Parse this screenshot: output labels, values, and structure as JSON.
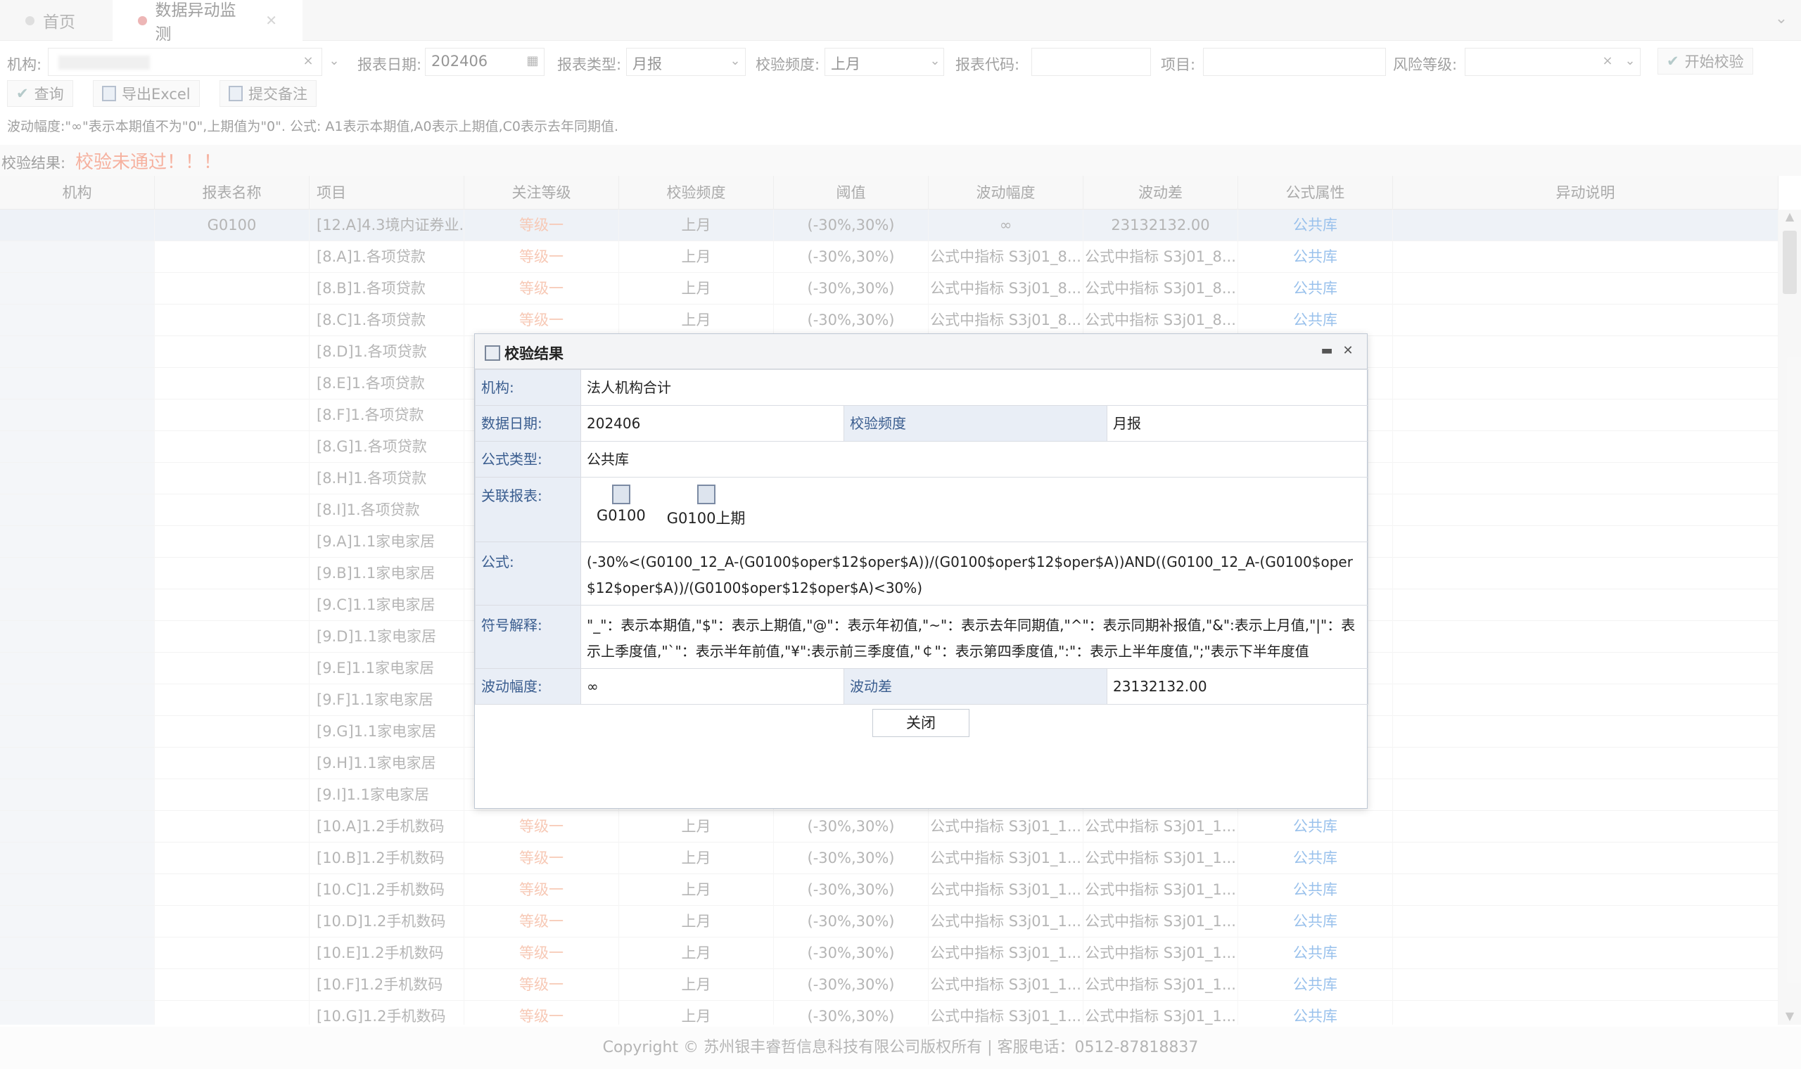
{
  "tabs": [
    {
      "label": "首页"
    },
    {
      "label": "数据异动监测"
    }
  ],
  "filters": {
    "org_label": "机构:",
    "date_label": "报表日期:",
    "date_value": "202406",
    "type_label": "报表类型:",
    "type_value": "月报",
    "freq_label": "校验频度:",
    "freq_value": "上月",
    "code_label": "报表代码:",
    "item_label": "项目:",
    "risk_label": "风险等级:",
    "start_label": "开始校验"
  },
  "toolbar": {
    "query": "查询",
    "export": "导出Excel",
    "submit": "提交备注"
  },
  "hint": "波动幅度:\"∞\"表示本期值不为\"0\",上期值为\"0\".    公式:  A1表示本期值,A0表示上期值,C0表示去年同期值.",
  "result": {
    "label": "校验结果:",
    "value": "校验未通过！！！"
  },
  "columns": [
    "机构",
    "报表名称",
    "项目",
    "关注等级",
    "校验频度",
    "阈值",
    "波动幅度",
    "波动差",
    "公式属性",
    "异动说明"
  ],
  "rows": [
    {
      "report": "G0100",
      "project": "[12.A]4.3境内证券业...",
      "level": "等级一",
      "freq": "上月",
      "threshold": "(-30%,30%)",
      "amp": "∞",
      "diff": "23132132.00",
      "attr": "公共库"
    },
    {
      "report": "",
      "project": "[8.A]1.各项贷款",
      "level": "等级一",
      "freq": "上月",
      "threshold": "(-30%,30%)",
      "amp": "公式中指标 S3j01_8...",
      "diff": "公式中指标 S3j01_8...",
      "attr": "公共库"
    },
    {
      "report": "",
      "project": "[8.B]1.各项贷款",
      "level": "等级一",
      "freq": "上月",
      "threshold": "(-30%,30%)",
      "amp": "公式中指标 S3j01_8...",
      "diff": "公式中指标 S3j01_8...",
      "attr": "公共库"
    },
    {
      "report": "",
      "project": "[8.C]1.各项贷款",
      "level": "等级一",
      "freq": "上月",
      "threshold": "(-30%,30%)",
      "amp": "公式中指标 S3j01_8...",
      "diff": "公式中指标 S3j01_8...",
      "attr": "公共库"
    },
    {
      "report": "",
      "project": "[8.D]1.各项贷款",
      "level": "",
      "freq": "",
      "threshold": "",
      "amp": "",
      "diff": "",
      "attr": ""
    },
    {
      "report": "",
      "project": "[8.E]1.各项贷款",
      "level": "",
      "freq": "",
      "threshold": "",
      "amp": "",
      "diff": "",
      "attr": ""
    },
    {
      "report": "",
      "project": "[8.F]1.各项贷款",
      "level": "",
      "freq": "",
      "threshold": "",
      "amp": "",
      "diff": "",
      "attr": ""
    },
    {
      "report": "",
      "project": "[8.G]1.各项贷款",
      "level": "",
      "freq": "",
      "threshold": "",
      "amp": "",
      "diff": "",
      "attr": ""
    },
    {
      "report": "",
      "project": "[8.H]1.各项贷款",
      "level": "",
      "freq": "",
      "threshold": "",
      "amp": "",
      "diff": "",
      "attr": ""
    },
    {
      "report": "",
      "project": "[8.I]1.各项贷款",
      "level": "",
      "freq": "",
      "threshold": "",
      "amp": "",
      "diff": "",
      "attr": ""
    },
    {
      "report": "",
      "project": "[9.A]1.1家电家居",
      "level": "",
      "freq": "",
      "threshold": "",
      "amp": "",
      "diff": "",
      "attr": ""
    },
    {
      "report": "",
      "project": "[9.B]1.1家电家居",
      "level": "",
      "freq": "",
      "threshold": "",
      "amp": "",
      "diff": "",
      "attr": ""
    },
    {
      "report": "",
      "project": "[9.C]1.1家电家居",
      "level": "",
      "freq": "",
      "threshold": "",
      "amp": "",
      "diff": "",
      "attr": ""
    },
    {
      "report": "",
      "project": "[9.D]1.1家电家居",
      "level": "",
      "freq": "",
      "threshold": "",
      "amp": "",
      "diff": "",
      "attr": ""
    },
    {
      "report": "",
      "project": "[9.E]1.1家电家居",
      "level": "",
      "freq": "",
      "threshold": "",
      "amp": "",
      "diff": "",
      "attr": ""
    },
    {
      "report": "",
      "project": "[9.F]1.1家电家居",
      "level": "",
      "freq": "",
      "threshold": "",
      "amp": "",
      "diff": "",
      "attr": ""
    },
    {
      "report": "",
      "project": "[9.G]1.1家电家居",
      "level": "",
      "freq": "",
      "threshold": "",
      "amp": "",
      "diff": "",
      "attr": ""
    },
    {
      "report": "",
      "project": "[9.H]1.1家电家居",
      "level": "",
      "freq": "",
      "threshold": "",
      "amp": "",
      "diff": "",
      "attr": ""
    },
    {
      "report": "",
      "project": "[9.I]1.1家电家居",
      "level": "",
      "freq": "",
      "threshold": "",
      "amp": "",
      "diff": "",
      "attr": ""
    },
    {
      "report": "",
      "project": "[10.A]1.2手机数码",
      "level": "等级一",
      "freq": "上月",
      "threshold": "(-30%,30%)",
      "amp": "公式中指标 S3j01_1...",
      "diff": "公式中指标 S3j01_1...",
      "attr": "公共库"
    },
    {
      "report": "",
      "project": "[10.B]1.2手机数码",
      "level": "等级一",
      "freq": "上月",
      "threshold": "(-30%,30%)",
      "amp": "公式中指标 S3j01_1...",
      "diff": "公式中指标 S3j01_1...",
      "attr": "公共库"
    },
    {
      "report": "",
      "project": "[10.C]1.2手机数码",
      "level": "等级一",
      "freq": "上月",
      "threshold": "(-30%,30%)",
      "amp": "公式中指标 S3j01_1...",
      "diff": "公式中指标 S3j01_1...",
      "attr": "公共库"
    },
    {
      "report": "",
      "project": "[10.D]1.2手机数码",
      "level": "等级一",
      "freq": "上月",
      "threshold": "(-30%,30%)",
      "amp": "公式中指标 S3j01_1...",
      "diff": "公式中指标 S3j01_1...",
      "attr": "公共库"
    },
    {
      "report": "",
      "project": "[10.E]1.2手机数码",
      "level": "等级一",
      "freq": "上月",
      "threshold": "(-30%,30%)",
      "amp": "公式中指标 S3j01_1...",
      "diff": "公式中指标 S3j01_1...",
      "attr": "公共库"
    },
    {
      "report": "",
      "project": "[10.F]1.2手机数码",
      "level": "等级一",
      "freq": "上月",
      "threshold": "(-30%,30%)",
      "amp": "公式中指标 S3j01_1...",
      "diff": "公式中指标 S3j01_1...",
      "attr": "公共库"
    },
    {
      "report": "",
      "project": "[10.G]1.2手机数码",
      "level": "等级一",
      "freq": "上月",
      "threshold": "(-30%,30%)",
      "amp": "公式中指标 S3j01_1...",
      "diff": "公式中指标 S3j01_1...",
      "attr": "公共库"
    }
  ],
  "footer": "Copyright © 苏州银丰睿哲信息科技有限公司版权所有 | 客服电话：0512-87818837",
  "dialog": {
    "title": "校验结果",
    "org_label": "机构:",
    "org_value": "法人机构合计",
    "date_label": "数据日期:",
    "date_value": "202406",
    "freq_label": "校验频度",
    "freq_value": "月报",
    "ftype_label": "公式类型:",
    "ftype_value": "公共库",
    "link_label": "关联报表:",
    "reports": [
      "G0100",
      "G0100上期"
    ],
    "formula_label": "公式:",
    "formula": "(-30%<(G0100_12_A-(G0100$oper$12$oper$A))/(G0100$oper$12$oper$A))AND((G0100_12_A-(G0100$oper$12$oper$A))/(G0100$oper$12$oper$A)<30%)",
    "symbol_label": "符号解释:",
    "symbol": "\"_\"：表示本期值,\"$\"：表示上期值,\"@\"：表示年初值,\"~\"：表示去年同期值,\"^\"：表示同期补报值,\"&\":表示上月值,\"|\"：表示上季度值,\"`\"：表示半年前值,\"¥\":表示前三季度值,\"￠\"：表示第四季度值,\":\"：表示上半年度值,\";\"表示下半年度值",
    "amp_label": "波动幅度:",
    "amp_value": "∞",
    "diff_label": "波动差",
    "diff_value": "23132132.00",
    "close": "关闭"
  }
}
